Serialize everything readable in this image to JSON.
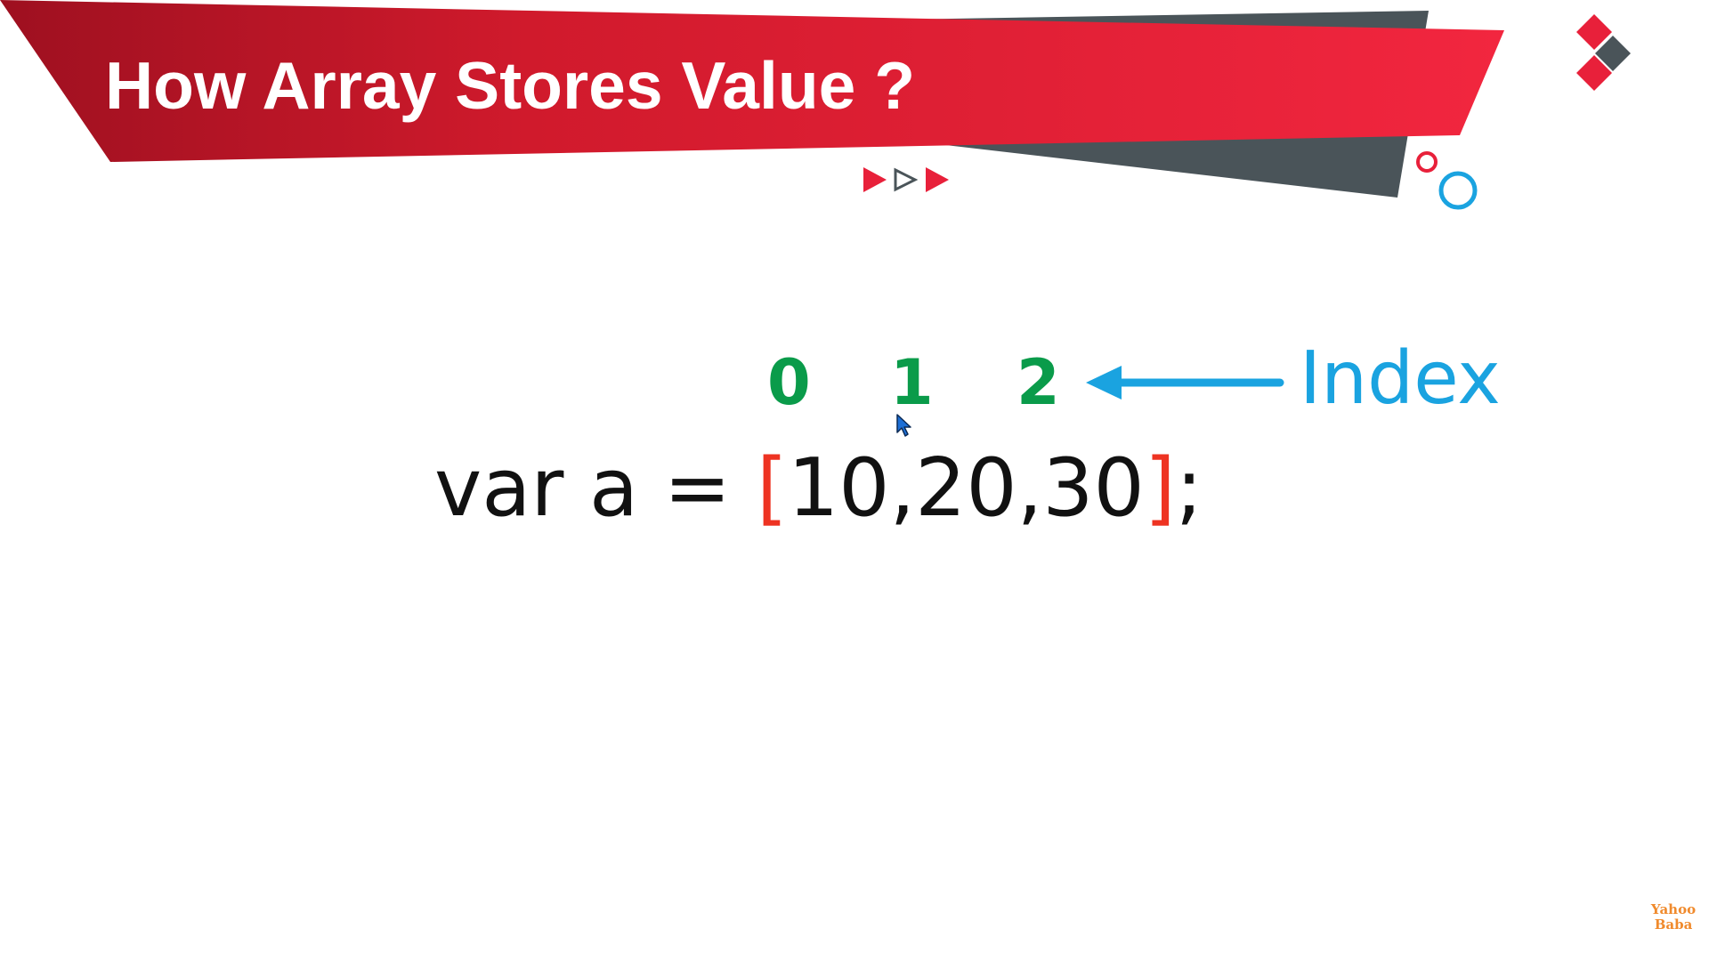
{
  "slide": {
    "title": "How Array Stores Value ?"
  },
  "decorations": {
    "banner": "red-slanted-title-banner",
    "shadow": "dark-gray-slanted-band",
    "play_arrows_icon": "triple-play-arrows-icon",
    "diamonds_icon": "diamond-cluster-icon",
    "circles_icon": "outline-circles-icon"
  },
  "indices": [
    "0",
    "1",
    "2"
  ],
  "index_label": "Index",
  "code": {
    "prefix": "var a = ",
    "open_bracket": "[",
    "values": "10,20,30",
    "close_bracket": "]",
    "suffix": ";"
  },
  "watermark": {
    "line1": "Yahoo",
    "line2": "Baba"
  },
  "colors": {
    "banner_red": "#e8203a",
    "banner_dark_red": "#a8121f",
    "shadow_gray": "#4a5459",
    "index_green": "#0a9b4a",
    "index_blue": "#1aa3e0",
    "bracket_red": "#ee3322",
    "code_text": "#111111",
    "watermark_orange": "#f08a2c"
  }
}
